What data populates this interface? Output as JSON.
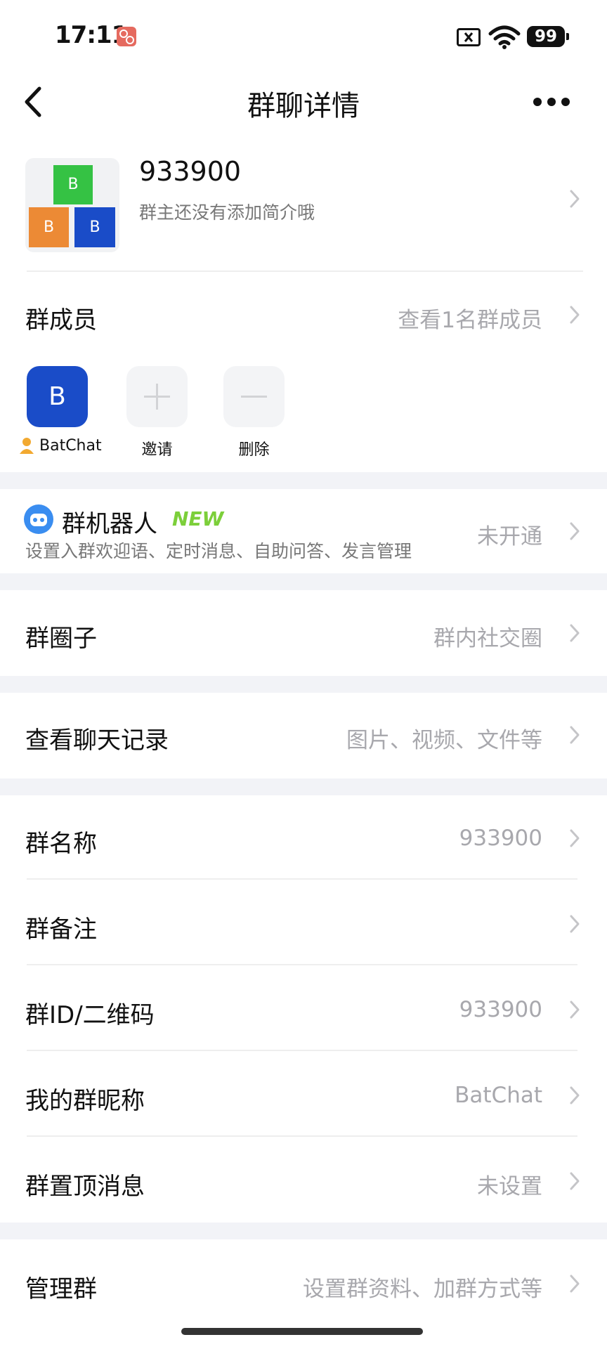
{
  "status_bar": {
    "time": "17:11",
    "battery": "99"
  },
  "header": {
    "title": "群聊详情"
  },
  "group": {
    "number": "933900",
    "intro": "群主还没有添加简介哦",
    "avatar_letter": "B"
  },
  "members": {
    "label": "群成员",
    "value": "查看1名群成员",
    "list": [
      {
        "name": "BatChat",
        "initial": "B"
      }
    ],
    "invite_label": "邀请",
    "delete_label": "删除"
  },
  "robot": {
    "title": "群机器人",
    "badge": "NEW",
    "description": "设置入群欢迎语、定时消息、自助问答、发言管理",
    "value": "未开通"
  },
  "circle": {
    "label": "群圈子",
    "value": "群内社交圈"
  },
  "history": {
    "label": "查看聊天记录",
    "value": "图片、视频、文件等"
  },
  "settings": [
    {
      "label": "群名称",
      "value": "933900"
    },
    {
      "label": "群备注",
      "value": ""
    },
    {
      "label": "群ID/二维码",
      "value": "933900"
    },
    {
      "label": "我的群昵称",
      "value": "BatChat"
    },
    {
      "label": "群置顶消息",
      "value": "未设置"
    }
  ],
  "manage": {
    "label": "管理群",
    "value": "设置群资料、加群方式等"
  }
}
